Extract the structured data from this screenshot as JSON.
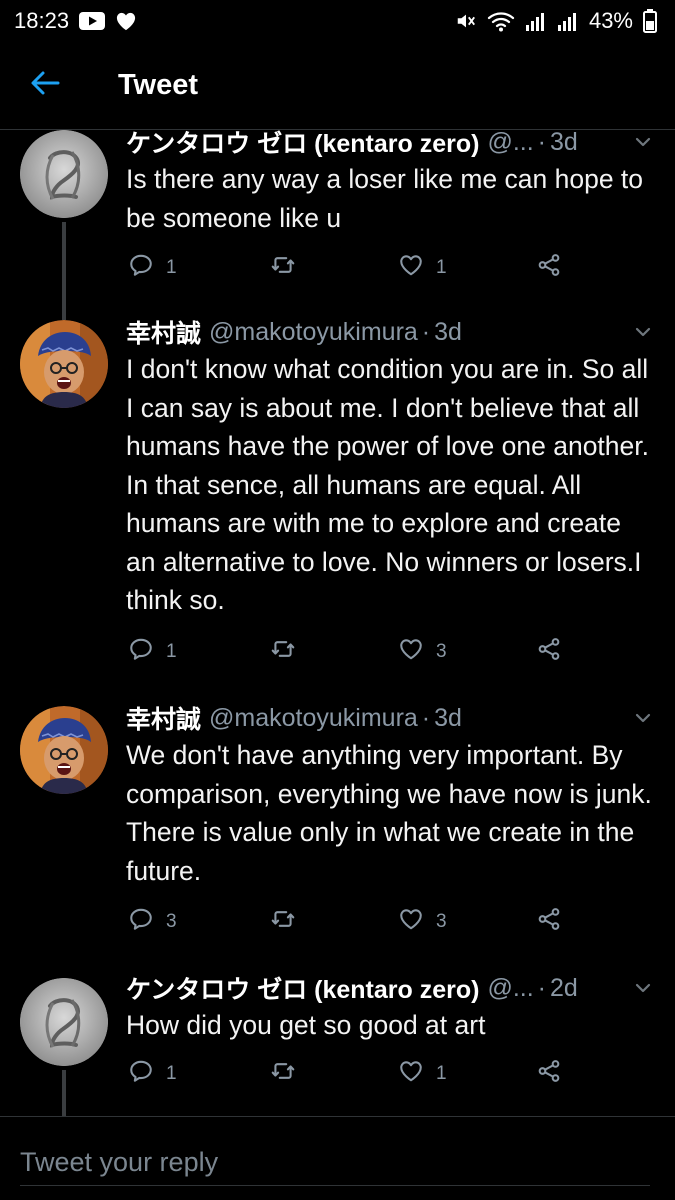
{
  "status_bar": {
    "time": "18:23",
    "battery": "43%",
    "icons": [
      "youtube-icon",
      "heart-icon",
      "mute-icon",
      "wifi-icon",
      "signal-icon",
      "signal-icon",
      "battery-icon"
    ]
  },
  "header": {
    "title": "Tweet",
    "back_icon": "arrow-left-icon"
  },
  "colors": {
    "accent": "#1da1f2",
    "background": "#000000",
    "muted": "#8b98a5"
  },
  "tweets": [
    {
      "name": "ケンタロウ ゼロ (kentaro zero)",
      "handle": "@...",
      "time": "3d",
      "text": "Is there any way a loser like me can hope to be someone like u",
      "replies": "1",
      "retweets": "",
      "likes": "1"
    },
    {
      "name": "幸村誠",
      "handle": "@makotoyukimura",
      "time": "3d",
      "text": "I don't know what condition you are in. So all I can say is about me. I don't believe that all humans have the power of love one another. In that sence, all humans are equal. All humans are with me to explore and create an alternative to love. No winners or losers.I think so.",
      "replies": "1",
      "retweets": "",
      "likes": "3"
    },
    {
      "name": "幸村誠",
      "handle": "@makotoyukimura",
      "time": "3d",
      "text": "We don't have anything very important. By comparison, everything we have now is junk. There is value only in what we create in the future.",
      "replies": "3",
      "retweets": "",
      "likes": "3"
    },
    {
      "name": "ケンタロウ ゼロ (kentaro zero)",
      "handle": "@...",
      "time": "2d",
      "text": "How did you get so good at art",
      "replies": "1",
      "retweets": "",
      "likes": "1"
    }
  ],
  "reply_box": {
    "placeholder": "Tweet your reply"
  }
}
